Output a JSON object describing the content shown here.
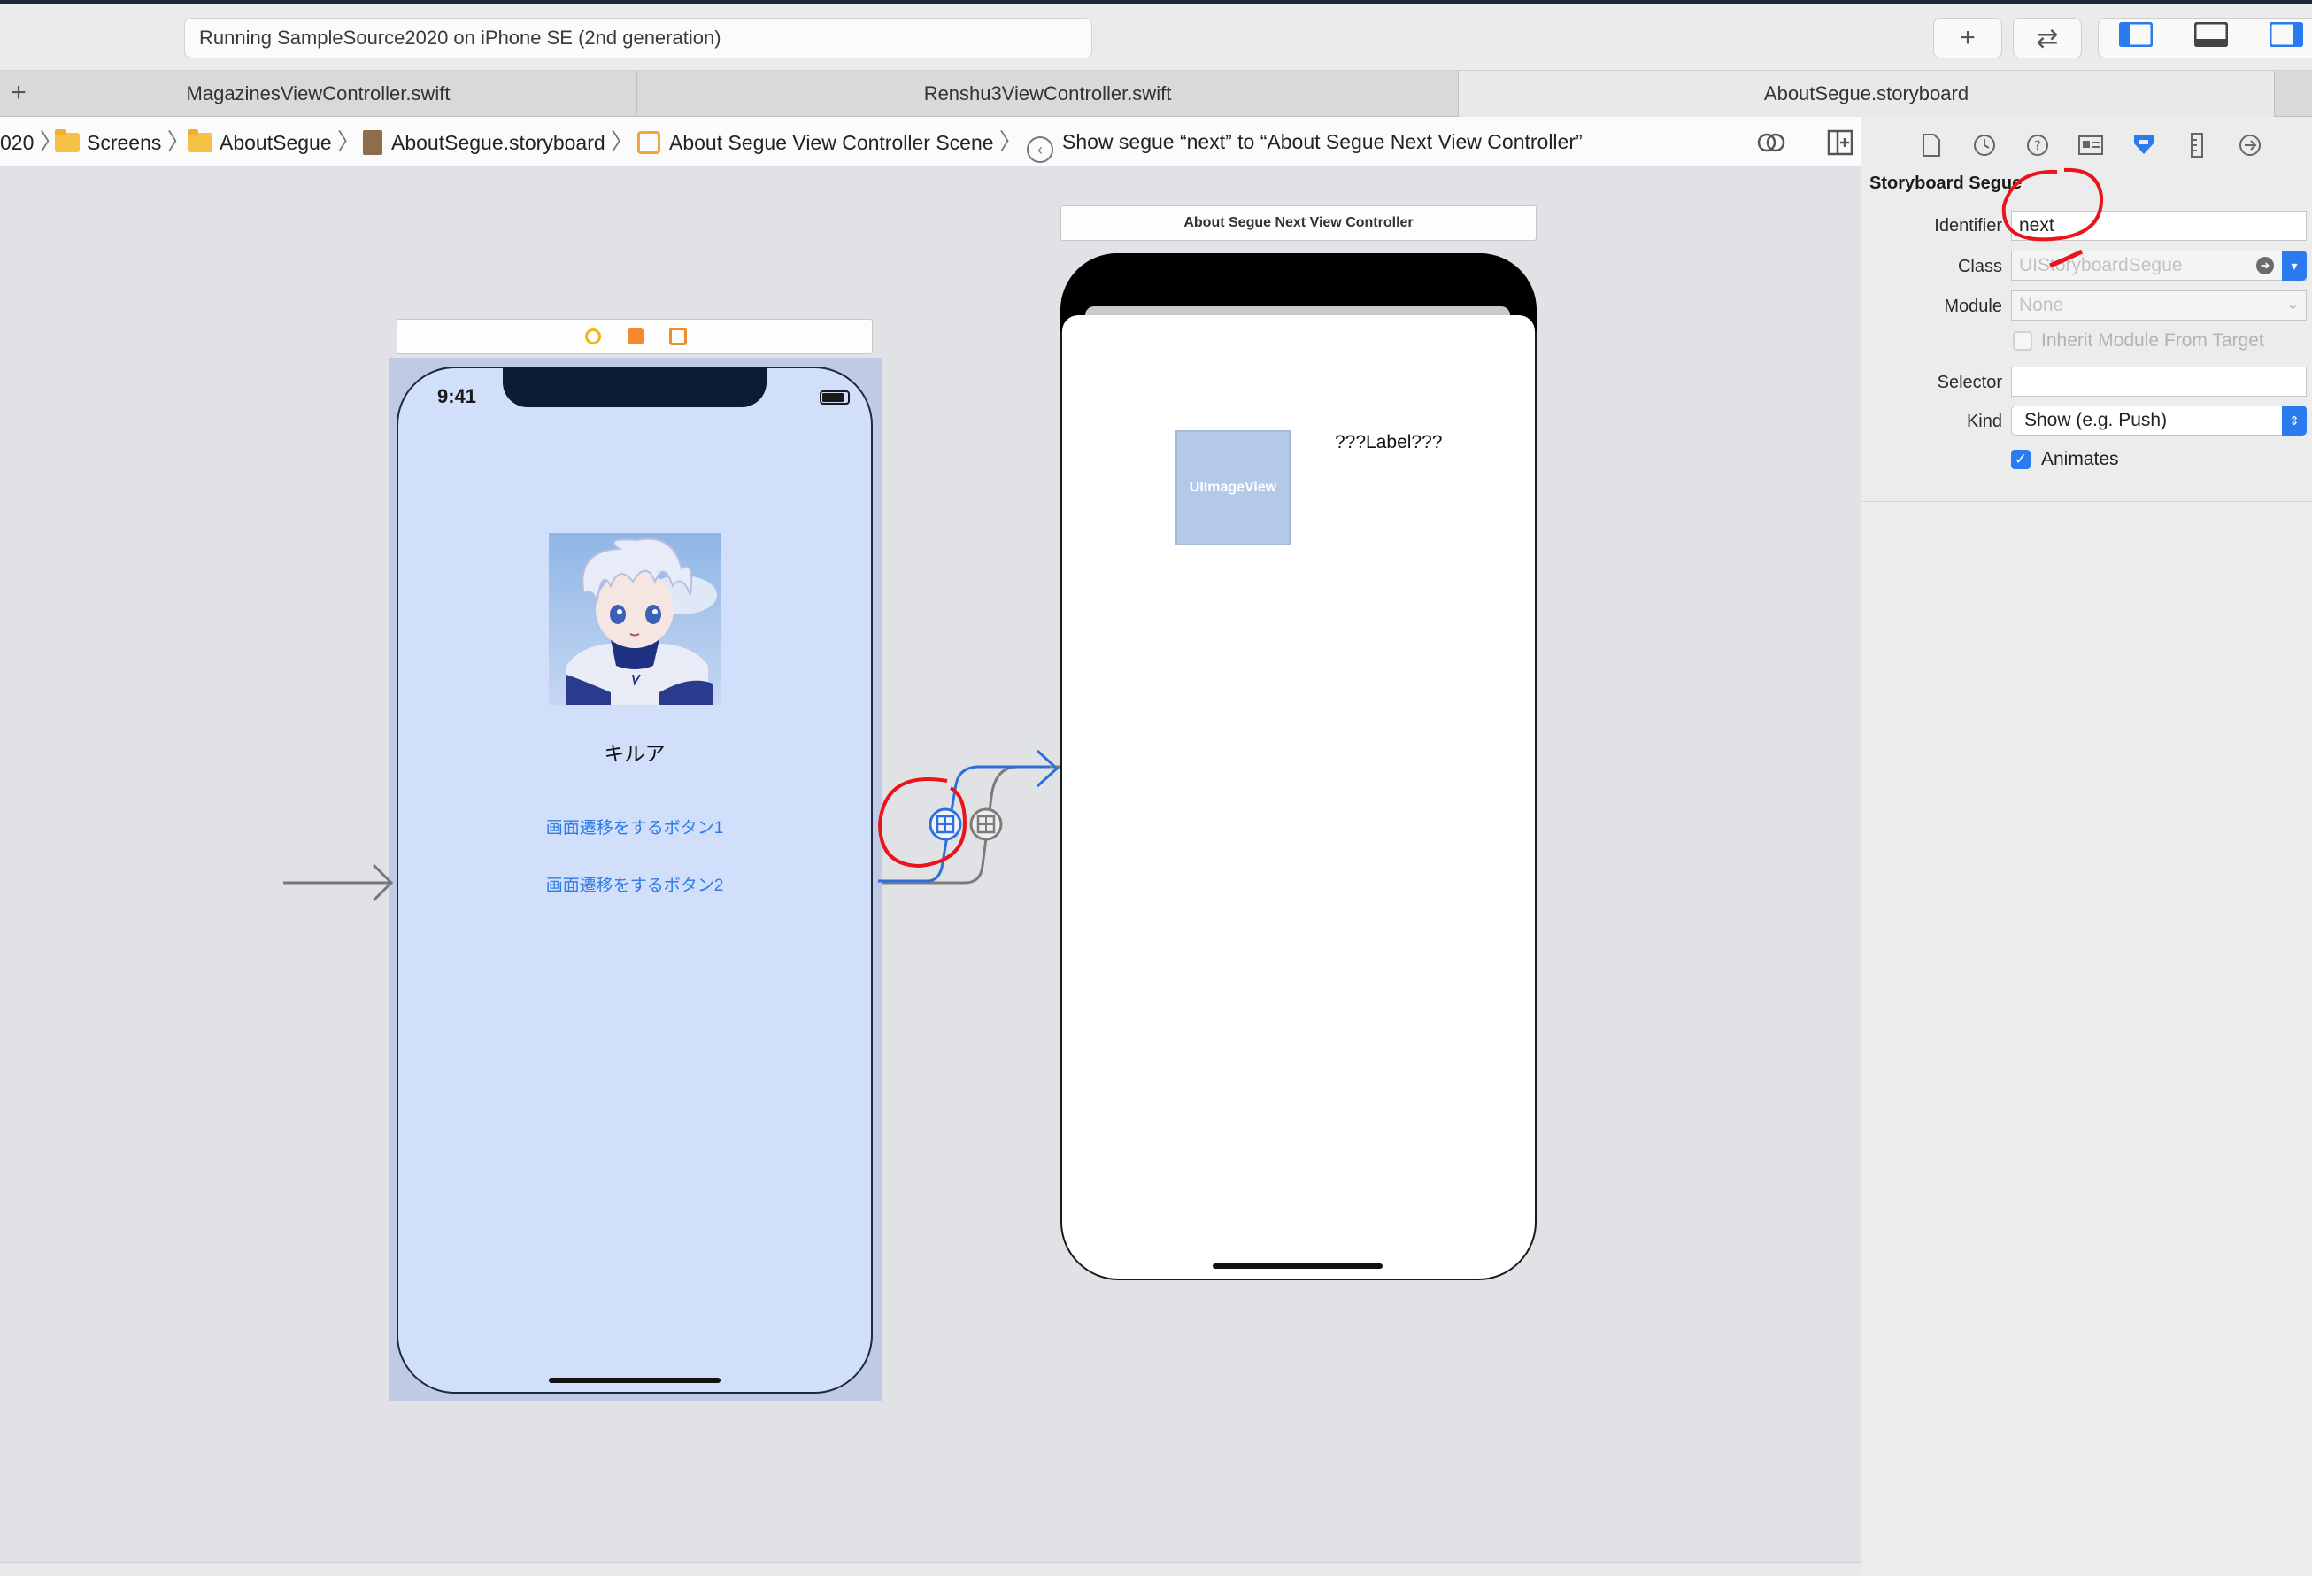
{
  "toolbar": {
    "activity_text": "Running SampleSource2020 on iPhone SE (2nd generation)",
    "add_label": "+",
    "code_review_label": "⇄"
  },
  "tabs": [
    {
      "label": "MagazinesViewController.swift",
      "active": false
    },
    {
      "label": "Renshu3ViewController.swift",
      "active": false
    },
    {
      "label": "AboutSegue.storyboard",
      "active": true
    }
  ],
  "tab_add_label": "+",
  "jumpbar": {
    "crumbs": [
      "020",
      "Screens",
      "AboutSegue",
      "AboutSegue.storyboard",
      "About Segue View Controller Scene",
      "Show segue “next” to “About Segue Next View Controller”"
    ]
  },
  "canvas": {
    "scene1": {
      "status_time": "9:41",
      "name_label": "キルア",
      "button1": "画面遷移をするボタン1",
      "button2": "画面遷移をするボタン2"
    },
    "scene2": {
      "title": "About Segue Next View Controller",
      "image_view_label": "UIImageView",
      "label_text": "???Label???"
    }
  },
  "inspector": {
    "section_title": "Storyboard Segue",
    "identifier_label": "Identifier",
    "identifier_value": "next",
    "class_label": "Class",
    "class_placeholder": "UIStoryboardSegue",
    "module_label": "Module",
    "module_placeholder": "None",
    "inherit_label": "Inherit Module From Target",
    "selector_label": "Selector",
    "selector_value": "",
    "kind_label": "Kind",
    "kind_value": "Show (e.g. Push)",
    "animates_label": "Animates",
    "animates_checked": true
  },
  "colors": {
    "accent": "#2b7bf0",
    "segue_selected": "#2e6fe0",
    "annotation_red": "#e8161c",
    "scene_bg": "#d2dffb"
  }
}
